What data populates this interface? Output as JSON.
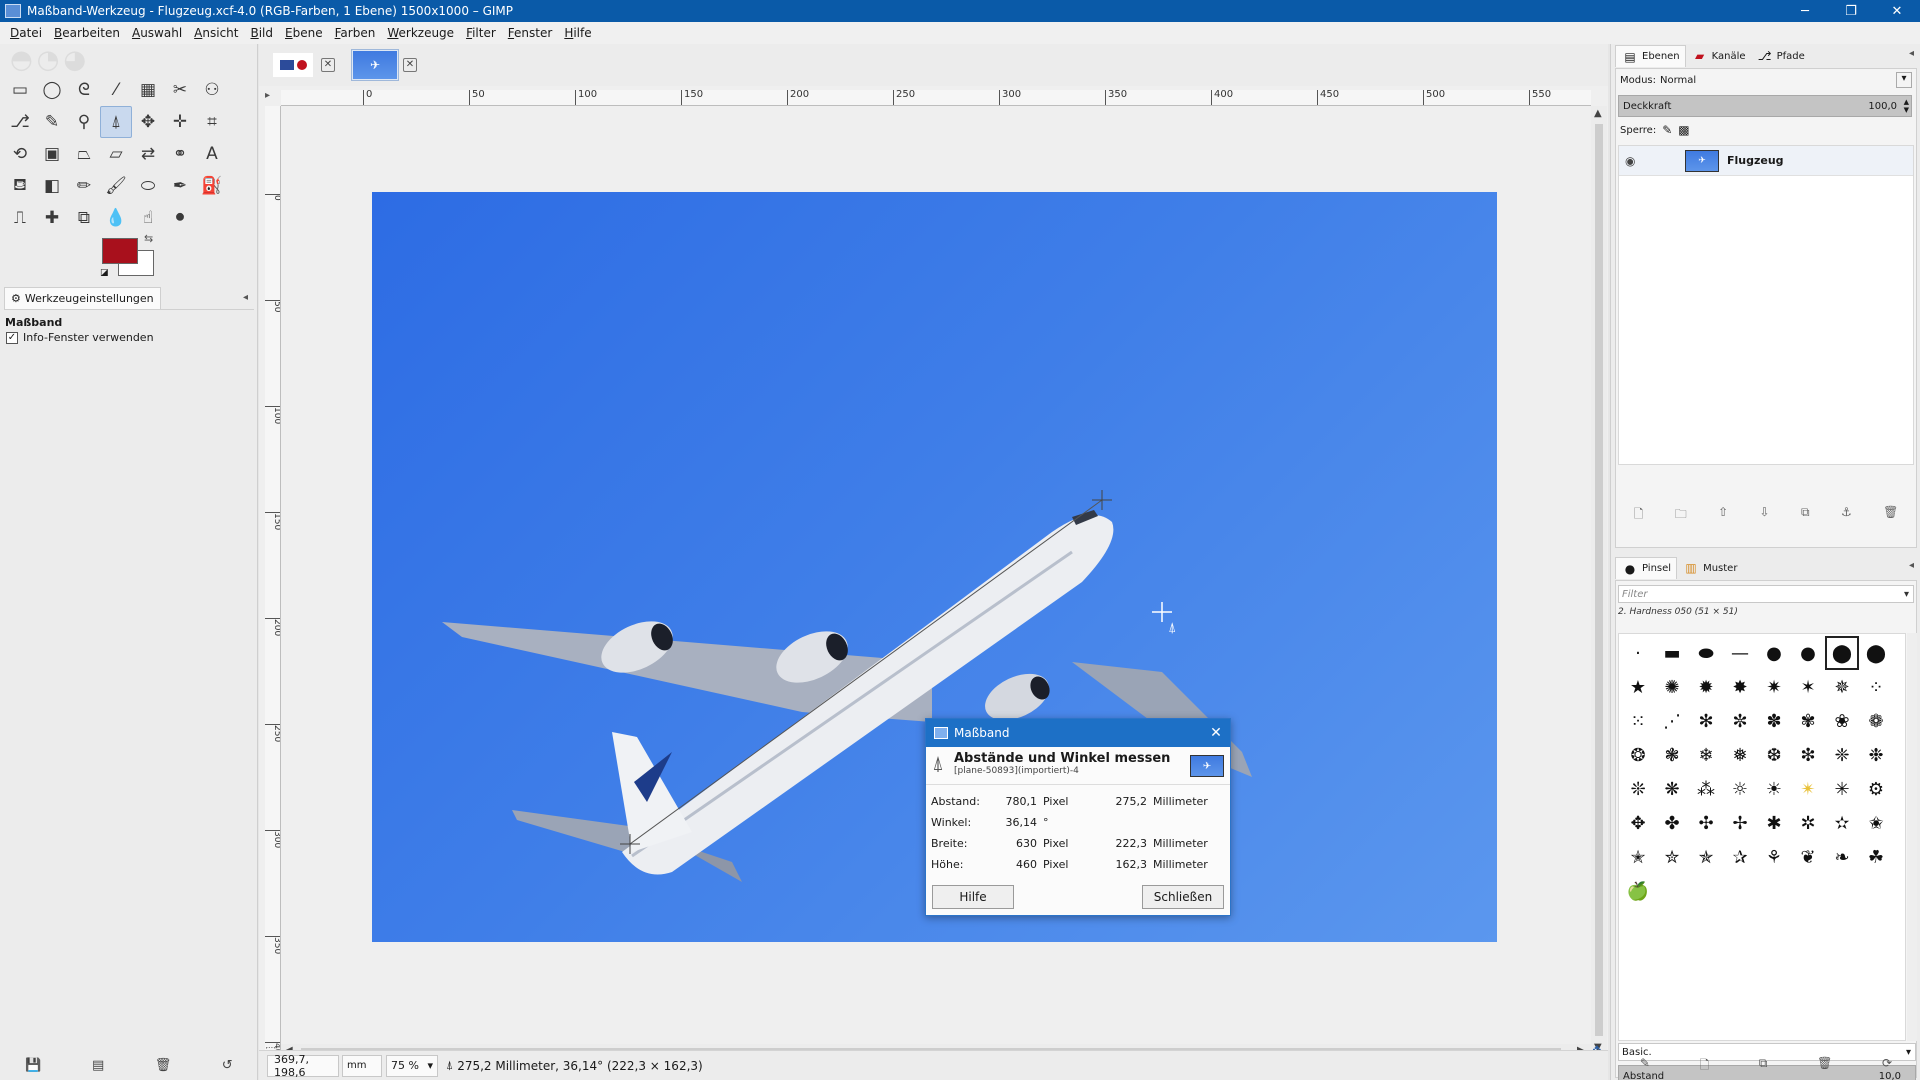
{
  "window": {
    "title": "Maßband-Werkzeug - Flugzeug.xcf-4.0 (RGB-Farben, 1 Ebene) 1500x1000 – GIMP",
    "minimize": "─",
    "maximize": "❐",
    "close": "✕"
  },
  "menu": [
    "Datei",
    "Bearbeiten",
    "Auswahl",
    "Ansicht",
    "Bild",
    "Ebene",
    "Farben",
    "Werkzeuge",
    "Filter",
    "Fenster",
    "Hilfe"
  ],
  "tools": [
    {
      "name": "rect-select-icon",
      "glyph": "▭"
    },
    {
      "name": "ellipse-select-icon",
      "glyph": "◯"
    },
    {
      "name": "free-select-icon",
      "glyph": "ᘓ"
    },
    {
      "name": "fuzzy-select-icon",
      "glyph": "⁄"
    },
    {
      "name": "select-by-color-icon",
      "glyph": "▦"
    },
    {
      "name": "scissors-icon",
      "glyph": "✂"
    },
    {
      "name": "foreground-select-icon",
      "glyph": "⚇"
    },
    {
      "name": "paths-icon",
      "glyph": "⎇"
    },
    {
      "name": "color-picker-icon",
      "glyph": "✎"
    },
    {
      "name": "zoom-icon",
      "glyph": "⚲"
    },
    {
      "name": "measure-icon",
      "glyph": "⍋",
      "active": true
    },
    {
      "name": "move-icon",
      "glyph": "✥"
    },
    {
      "name": "align-icon",
      "glyph": "✛"
    },
    {
      "name": "crop-icon",
      "glyph": "⌗"
    },
    {
      "name": "unified-transform-icon",
      "glyph": "⟲"
    },
    {
      "name": "cage-transform-icon",
      "glyph": "▣"
    },
    {
      "name": "perspective-icon",
      "glyph": "⏢"
    },
    {
      "name": "flip-icon",
      "glyph": "⏥"
    },
    {
      "name": "warp-icon",
      "glyph": "⇄"
    },
    {
      "name": "handle-transform-icon",
      "glyph": "⚭"
    },
    {
      "name": "text-icon",
      "glyph": "A"
    },
    {
      "name": "bucket-fill-icon",
      "glyph": "⛾"
    },
    {
      "name": "gradient-icon",
      "glyph": "◧"
    },
    {
      "name": "pencil-icon",
      "glyph": "✏"
    },
    {
      "name": "paintbrush-icon",
      "glyph": "🖌"
    },
    {
      "name": "eraser-icon",
      "glyph": "⬭"
    },
    {
      "name": "airbrush-icon",
      "glyph": "✒"
    },
    {
      "name": "ink-icon",
      "glyph": "⛽"
    },
    {
      "name": "clone-icon",
      "glyph": "⎍"
    },
    {
      "name": "heal-icon",
      "glyph": "✚"
    },
    {
      "name": "perspective-clone-icon",
      "glyph": "⧉"
    },
    {
      "name": "blur-icon",
      "glyph": "💧"
    },
    {
      "name": "smudge-icon",
      "glyph": "☝"
    },
    {
      "name": "dodge-burn-icon",
      "glyph": "⚫"
    }
  ],
  "colors": {
    "foreground": "#a8101c",
    "background": "#ffffff",
    "accent": "#1d70c6"
  },
  "tool_options": {
    "tab_label": "Werkzeugeinstellungen",
    "tool_name": "Maßband",
    "option_label": "Info-Fenster verwenden",
    "option_checked": "✓"
  },
  "ruler": {
    "h_labels": [
      "0",
      "50",
      "100",
      "150",
      "200",
      "250",
      "300",
      "350",
      "400",
      "450",
      "500",
      "550"
    ],
    "v_labels": [
      "0",
      "50",
      "100",
      "150",
      "200",
      "250",
      "300",
      "350",
      "400"
    ]
  },
  "status": {
    "coords": "369,7, 198,6",
    "unit": "mm",
    "zoom": "75 %",
    "message": "275,2 Millimeter, 36,14° (222,3 × 162,3)"
  },
  "dialog": {
    "title": "Maßband",
    "heading": "Abstände und Winkel messen",
    "subheading": "[plane-50893](importiert)-4",
    "rows": [
      {
        "label": "Abstand:",
        "v1": "780,1",
        "u1": "Pixel",
        "v2": "275,2",
        "u2": "Millimeter"
      },
      {
        "label": "Winkel:",
        "v1": "36,14",
        "u1": "°",
        "v2": "",
        "u2": ""
      },
      {
        "label": "Breite:",
        "v1": "630",
        "u1": "Pixel",
        "v2": "222,3",
        "u2": "Millimeter"
      },
      {
        "label": "Höhe:",
        "v1": "460",
        "u1": "Pixel",
        "v2": "162,3",
        "u2": "Millimeter"
      }
    ],
    "help_button": "Hilfe",
    "close_button": "Schließen"
  },
  "layers": {
    "tabs": [
      "Ebenen",
      "Kanäle",
      "Pfade"
    ],
    "mode_label": "Modus:",
    "mode_value": "Normal",
    "opacity_label": "Deckkraft",
    "opacity_value": "100,0",
    "lock_label": "Sperre:",
    "layer_name": "Flugzeug"
  },
  "brushes": {
    "tabs": [
      "Pinsel",
      "Muster"
    ],
    "filter_placeholder": "Filter",
    "selected_brush": "2. Hardness 050 (51 × 51)",
    "preset": "Basic.",
    "spacing_label": "Abstand",
    "spacing_value": "10,0"
  }
}
